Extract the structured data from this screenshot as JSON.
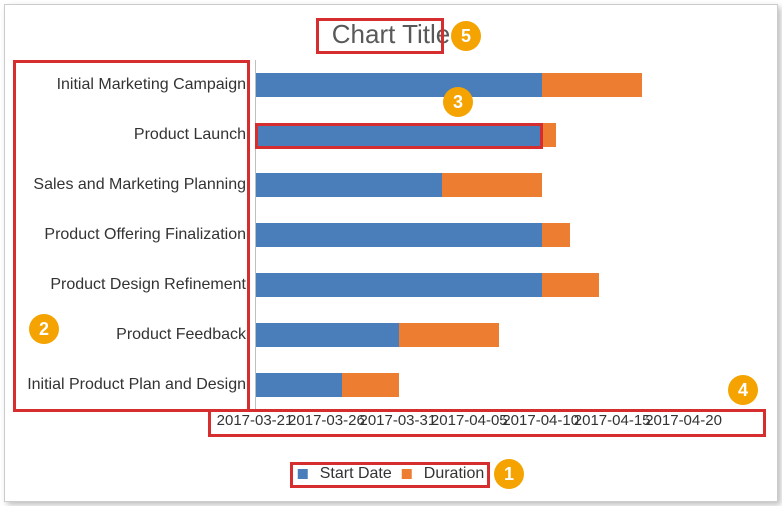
{
  "chart_data": {
    "type": "bar",
    "title": "Chart Title",
    "orientation": "horizontal",
    "stacked": true,
    "categories": [
      "Initial Marketing Campaign",
      "Product Launch",
      "Sales and Marketing Planning",
      "Product Offering Finalization",
      "Product Design Refinement",
      "Product Feedback",
      "Initial Product Plan and Design"
    ],
    "series": [
      {
        "name": "Start Date",
        "color": "#4a7ebb",
        "values": [
          "2017-04-10",
          "2017-04-10",
          "2017-04-03",
          "2017-04-10",
          "2017-04-10",
          "2017-03-31",
          "2017-03-27"
        ]
      },
      {
        "name": "Duration",
        "color": "#ed7d31",
        "values": [
          7,
          1,
          7,
          2,
          4,
          7,
          4
        ]
      }
    ],
    "x_axis": {
      "type": "date",
      "min": "2017-03-21",
      "max": "2017-04-25",
      "ticks": [
        "2017-03-21",
        "2017-03-26",
        "2017-03-31",
        "2017-04-05",
        "2017-04-10",
        "2017-04-15",
        "2017-04-20"
      ]
    },
    "legend": {
      "position": "bottom"
    }
  },
  "annotations": {
    "callouts": [
      "1",
      "2",
      "3",
      "4",
      "5"
    ]
  }
}
